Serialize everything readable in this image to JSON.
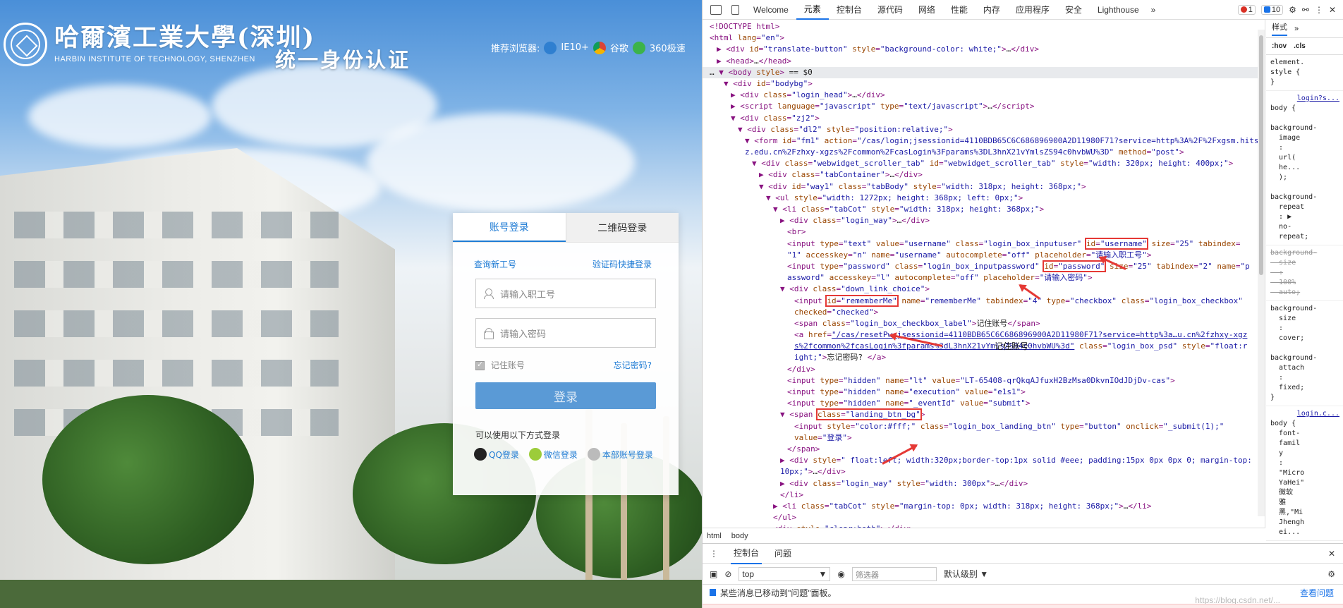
{
  "login_page": {
    "logo_cn": "哈爾濱工業大學(深圳)",
    "logo_en": "HARBIN INSTITUTE OF TECHNOLOGY, SHENZHEN",
    "sso_title": "统一身份认证",
    "browsers": {
      "label": "推荐浏览器:",
      "items": [
        "IE10+",
        "谷歌",
        "360极速"
      ]
    },
    "tabs": {
      "account": "账号登录",
      "qrcode": "二维码登录"
    },
    "links": {
      "query_id": "查询新工号",
      "sms_login": "验证码快捷登录"
    },
    "username_placeholder": "请输入职工号",
    "password_placeholder": "请输入密码",
    "remember_label": "记住账号",
    "forgot_label": "忘记密码?",
    "login_button": "登录",
    "other_title": "可以使用以下方式登录",
    "other_methods": [
      "QQ登录",
      "微信登录",
      "本部账号登录"
    ]
  },
  "devtools": {
    "tabs": [
      "Welcome",
      "元素",
      "控制台",
      "源代码",
      "网络",
      "性能",
      "内存",
      "应用程序",
      "安全",
      "Lighthouse"
    ],
    "active_tab": "元素",
    "errors": "1",
    "messages": "10",
    "breadcrumbs": [
      "html",
      "body"
    ],
    "styles_tabs": {
      "styles": "样式",
      "more": "»"
    },
    "styles_filter": [
      ":hov",
      ".cls"
    ],
    "styles_rules": [
      {
        "text": "element.\nstyle {\n}"
      },
      {
        "src": "login?s...",
        "text": "body {\n\nbackground-\n  image\n  :\n  url(\n  he...\n  );\n\nbackground-\n  repeat\n  : ▶\n  no-\n  repeat;"
      },
      {
        "text": "background-\n  size\n  :\n  100%\n  auto;",
        "struck": true
      },
      {
        "text": "background-\n  size\n  :\n  cover;\n\nbackground-\n  attach\n  :\n  fixed;\n}"
      },
      {
        "src": "login.c...",
        "text": "body {\n  font-\n  famil\n  y\n  :\n  \"Micro\n  YaHei\"\n  微软\n  雅\n  黑,\"Mi\n  Jhengh\n  ei..."
      }
    ],
    "dom_lines": [
      {
        "indent": 0,
        "html": "&lt;!DOCTYPE html&gt;"
      },
      {
        "indent": 0,
        "html": "<span class='tag'>&lt;html</span> <span class='an'>lang</span>=<span class='av'>\"en\"</span><span class='tag'>&gt;</span>"
      },
      {
        "indent": 1,
        "html": "▶ <span class='tag'>&lt;div</span> <span class='an'>id</span>=<span class='av'>\"translate-button\"</span> <span class='an'>style</span>=<span class='av'>\"background-color: white;\"</span><span class='tag'>&gt;</span><span class='tx'>…</span><span class='tag'>&lt;/div&gt;</span>"
      },
      {
        "indent": 1,
        "html": "▶ <span class='tag'>&lt;head&gt;</span><span class='tx'>…</span><span class='tag'>&lt;/head&gt;</span>"
      },
      {
        "indent": 0,
        "html": "<span class='tx'>… </span>▼ <span class='tag'>&lt;body</span> <span class='an'>style</span><span class='tag'>&gt;</span> <span class='tx'>== $0</span>",
        "selected": true
      },
      {
        "indent": 2,
        "html": "▼ <span class='tag'>&lt;div</span> <span class='an'>id</span>=<span class='av'>\"bodybg\"</span><span class='tag'>&gt;</span>"
      },
      {
        "indent": 3,
        "html": "▶ <span class='tag'>&lt;div</span> <span class='an'>class</span>=<span class='av'>\"login_head\"</span><span class='tag'>&gt;</span><span class='tx'>…</span><span class='tag'>&lt;/div&gt;</span>"
      },
      {
        "indent": 3,
        "html": "▶ <span class='tag'>&lt;script</span> <span class='an'>language</span>=<span class='av'>\"javascript\"</span> <span class='an'>type</span>=<span class='av'>\"text/javascript\"</span><span class='tag'>&gt;</span><span class='tx'>…</span><span class='tag'>&lt;/script&gt;</span>"
      },
      {
        "indent": 3,
        "html": "▼ <span class='tag'>&lt;div</span> <span class='an'>class</span>=<span class='av'>\"zj2\"</span><span class='tag'>&gt;</span>"
      },
      {
        "indent": 4,
        "html": "▼ <span class='tag'>&lt;div</span> <span class='an'>class</span>=<span class='av'>\"dl2\"</span> <span class='an'>style</span>=<span class='av'>\"position:relative;\"</span><span class='tag'>&gt;</span>"
      },
      {
        "indent": 5,
        "html": "▼ <span class='tag'>&lt;form</span> <span class='an'>id</span>=<span class='av'>\"fm1\"</span> <span class='an'>action</span>=<span class='av'>\"/cas/login;jsessionid=4110BDB65C6C686896900A2D11980F71?service=http%3A%2F%2Fxgsm.hits</span>"
      },
      {
        "indent": 5,
        "html": "<span class='av'>z.edu.cn%2Fzhxy-xgzs%2Fcommon%2FcasLogin%3Fparams%3DL3hnX21vYmlsZS94c0hvbWU%3D\"</span> <span class='an'>method</span>=<span class='av'>\"post\"</span><span class='tag'>&gt;</span>"
      },
      {
        "indent": 6,
        "html": "▼ <span class='tag'>&lt;div</span> <span class='an'>class</span>=<span class='av'>\"webwidget_scroller_tab\"</span> <span class='an'>id</span>=<span class='av'>\"webwidget_scroller_tab\"</span> <span class='an'>style</span>=<span class='av'>\"width: 320px; height: 400px;\"</span><span class='tag'>&gt;</span>"
      },
      {
        "indent": 7,
        "html": "▶ <span class='tag'>&lt;div</span> <span class='an'>class</span>=<span class='av'>\"tabContainer\"</span><span class='tag'>&gt;</span><span class='tx'>…</span><span class='tag'>&lt;/div&gt;</span>"
      },
      {
        "indent": 7,
        "html": "▼ <span class='tag'>&lt;div</span> <span class='an'>id</span>=<span class='av'>\"way1\"</span> <span class='an'>class</span>=<span class='av'>\"tabBody\"</span> <span class='an'>style</span>=<span class='av'>\"width: 318px; height: 368px;\"</span><span class='tag'>&gt;</span>"
      },
      {
        "indent": 8,
        "html": "▼ <span class='tag'>&lt;ul</span> <span class='an'>style</span>=<span class='av'>\"width: 1272px; height: 368px; left: 0px;\"</span><span class='tag'>&gt;</span>"
      },
      {
        "indent": 9,
        "html": "▼ <span class='tag'>&lt;li</span> <span class='an'>class</span>=<span class='av'>\"tabCot\"</span> <span class='an'>style</span>=<span class='av'>\"width: 318px; height: 368px;\"</span><span class='tag'>&gt;</span>"
      },
      {
        "indent": 10,
        "html": "▶ <span class='tag'>&lt;div</span> <span class='an'>class</span>=<span class='av'>\"login_way\"</span><span class='tag'>&gt;</span><span class='tx'>…</span><span class='tag'>&lt;/div&gt;</span>"
      },
      {
        "indent": 11,
        "html": "<span class='tag'>&lt;br&gt;</span>"
      },
      {
        "indent": 11,
        "html": "<span class='tag'>&lt;input</span> <span class='an'>type</span>=<span class='av'>\"text\"</span> <span class='an'>value</span>=<span class='av'>\"username\"</span> <span class='an'>class</span>=<span class='av'>\"login_box_inputuser\"</span> <span class='hl'><span class='an'>id</span>=<span class='av'>\"username\"</span></span> <span class='an'>size</span>=<span class='av'>\"25\"</span> <span class='an'>tabindex</span>="
      },
      {
        "indent": 11,
        "html": "<span class='av'>\"1\"</span> <span class='an'>accesskey</span>=<span class='av'>\"n\"</span> <span class='an'>name</span>=<span class='av'>\"username\"</span> <span class='an'>autocomplete</span>=<span class='av'>\"off\"</span> <span class='an'>placeholder</span>=<span class='av'>\"请输入职工号\"</span><span class='tag'>&gt;</span>"
      },
      {
        "indent": 11,
        "html": "<span class='tag'>&lt;input</span> <span class='an'>type</span>=<span class='av'>\"password\"</span> <span class='an'>class</span>=<span class='av'>\"login_box_inputpassword\"</span> <span class='hl'><span class='an'>id</span>=<span class='av'>\"password\"</span></span> <span class='an'>size</span>=<span class='av'>\"25\"</span> <span class='an'>tabindex</span>=<span class='av'>\"2\"</span> <span class='an'>name</span>=<span class='av'>\"p</span>"
      },
      {
        "indent": 11,
        "html": "<span class='av'>assword\"</span> <span class='an'>accesskey</span>=<span class='av'>\"l\"</span> <span class='an'>autocomplete</span>=<span class='av'>\"off\"</span> <span class='an'>placeholder</span>=<span class='av'>\"请输入密码\"</span><span class='tag'>&gt;</span>"
      },
      {
        "indent": 10,
        "html": "▼ <span class='tag'>&lt;div</span> <span class='an'>class</span>=<span class='av'>\"down_link_choice\"</span><span class='tag'>&gt;</span>"
      },
      {
        "indent": 12,
        "html": "<span class='tag'>&lt;input</span> <span class='hl'><span class='an'>id</span>=<span class='av'>\"rememberMe\"</span></span> <span class='an'>name</span>=<span class='av'>\"rememberMe\"</span> <span class='an'>tabindex</span>=<span class='av'>\"4\"</span> <span class='an'>type</span>=<span class='av'>\"checkbox\"</span> <span class='an'>class</span>=<span class='av'>\"login_box_checkbox\"</span>"
      },
      {
        "indent": 12,
        "html": "<span class='an'>checked</span>=<span class='av'>\"checked\"</span><span class='tag'>&gt;</span>"
      },
      {
        "indent": 12,
        "html": "<span class='tag'>&lt;span</span> <span class='an'>class</span>=<span class='av'>\"login_box_checkbox_label\"</span><span class='tag'>&gt;</span><span class='tx'>记住账号</span><span class='tag'>&lt;/span&gt;</span>"
      },
      {
        "indent": 12,
        "html": "<span class='tag'>&lt;a</span> <span class='an'>href</span>=<span class='av' style='text-decoration:underline'>\"/cas/resetPw;jsessionid=4110BDB65C6C686896900A2D11980F71?service=http%3a…u.cn%2fzhxy-xgz</span>"
      },
      {
        "indent": 12,
        "html": "<span class='av' style='text-decoration:underline'>s%2fcommon%2fcasLogin%3fparams%3dL3hnX21vYmlsZS94c0hvbWU%3d\"</span> <span class='an'>class</span>=<span class='av'>\"login_box_psd\"</span> <span class='an'>style</span>=<span class='av'>\"float:r</span>"
      },
      {
        "indent": 12,
        "html": "<span class='av'>ight;\"</span><span class='tag'>&gt;</span><span class='tx'>忘记密码?</span> <span class='tag'>&lt;/a&gt;</span>"
      },
      {
        "indent": 11,
        "html": "<span class='tag'>&lt;/div&gt;</span>"
      },
      {
        "indent": 11,
        "html": "<span class='tag'>&lt;input</span> <span class='an'>type</span>=<span class='av'>\"hidden\"</span> <span class='an'>name</span>=<span class='av'>\"lt\"</span> <span class='an'>value</span>=<span class='av'>\"LT-65408-qrQkqAJfuxH2BzMsa0DkvnIOdJDjDv-cas\"</span><span class='tag'>&gt;</span>"
      },
      {
        "indent": 11,
        "html": "<span class='tag'>&lt;input</span> <span class='an'>type</span>=<span class='av'>\"hidden\"</span> <span class='an'>name</span>=<span class='av'>\"execution\"</span> <span class='an'>value</span>=<span class='av'>\"e1s1\"</span><span class='tag'>&gt;</span>"
      },
      {
        "indent": 11,
        "html": "<span class='tag'>&lt;input</span> <span class='an'>type</span>=<span class='av'>\"hidden\"</span> <span class='an'>name</span>=<span class='av'>\"_eventId\"</span> <span class='an'>value</span>=<span class='av'>\"submit\"</span><span class='tag'>&gt;</span>"
      },
      {
        "indent": 10,
        "html": "▼ <span class='tag'>&lt;span</span> <span class='hl'><span class='an'>class</span>=<span class='av'>\"landing_btn_bg\"</span></span><span class='tag'>&gt;</span>"
      },
      {
        "indent": 12,
        "html": "<span class='tag'>&lt;input</span> <span class='an'>style</span>=<span class='av'>\"color:#fff;\"</span> <span class='an'>class</span>=<span class='av'>\"login_box_landing_btn\"</span> <span class='an'>type</span>=<span class='av'>\"button\"</span> <span class='an'>onclick</span>=<span class='av'>\"_submit(1);\"</span>"
      },
      {
        "indent": 12,
        "html": "<span class='an'>value</span>=<span class='av'>\"登录\"</span><span class='tag'>&gt;</span>"
      },
      {
        "indent": 11,
        "html": "<span class='tag'>&lt;/span&gt;</span>"
      },
      {
        "indent": 10,
        "html": "▶ <span class='tag'>&lt;div</span> <span class='an'>style</span>=<span class='av'>\" float:left; width:320px;border-top:1px solid #eee; padding:15px 0px 0px 0; margin-top:</span>"
      },
      {
        "indent": 10,
        "html": "<span class='av'>10px;\"</span><span class='tag'>&gt;</span><span class='tx'>…</span><span class='tag'>&lt;/div&gt;</span>"
      },
      {
        "indent": 10,
        "html": "▶ <span class='tag'>&lt;div</span> <span class='an'>class</span>=<span class='av'>\"login_way\"</span> <span class='an'>style</span>=<span class='av'>\"width: 300px\"</span><span class='tag'>&gt;</span><span class='tx'>…</span><span class='tag'>&lt;/div&gt;</span>"
      },
      {
        "indent": 10,
        "html": "<span class='tag'>&lt;/li&gt;</span>"
      },
      {
        "indent": 9,
        "html": "▶ <span class='tag'>&lt;li</span> <span class='an'>class</span>=<span class='av'>\"tabCot\"</span> <span class='an'>style</span>=<span class='av'>\"margin-top: 0px; width: 318px; height: 368px;\"</span><span class='tag'>&gt;</span><span class='tx'>…</span><span class='tag'>&lt;/li&gt;</span>"
      },
      {
        "indent": 9,
        "html": "<span class='tag'>&lt;/ul&gt;</span>"
      },
      {
        "indent": 9,
        "html": "<span class='tag'>&lt;div</span> <span class='an'>style</span>=<span class='av'>\"clear:both\"</span><span class='tag'>&gt;</span><span class='tag'>&lt;/div&gt;</span>"
      }
    ],
    "annotation_remember": "记住账号",
    "drawer": {
      "tabs": [
        "控制台",
        "问题"
      ],
      "context": "top",
      "filter_placeholder": "筛选器",
      "level": "默认级别",
      "message": "某些消息已移动到\"问题\"面板。",
      "view_issues": "查看问题",
      "watermark": "https://blog.csdn.net/..."
    }
  },
  "colors": {
    "accent": "#1e7bd4",
    "login_button": "#5a9ad6",
    "annotation_red": "#e53935"
  }
}
